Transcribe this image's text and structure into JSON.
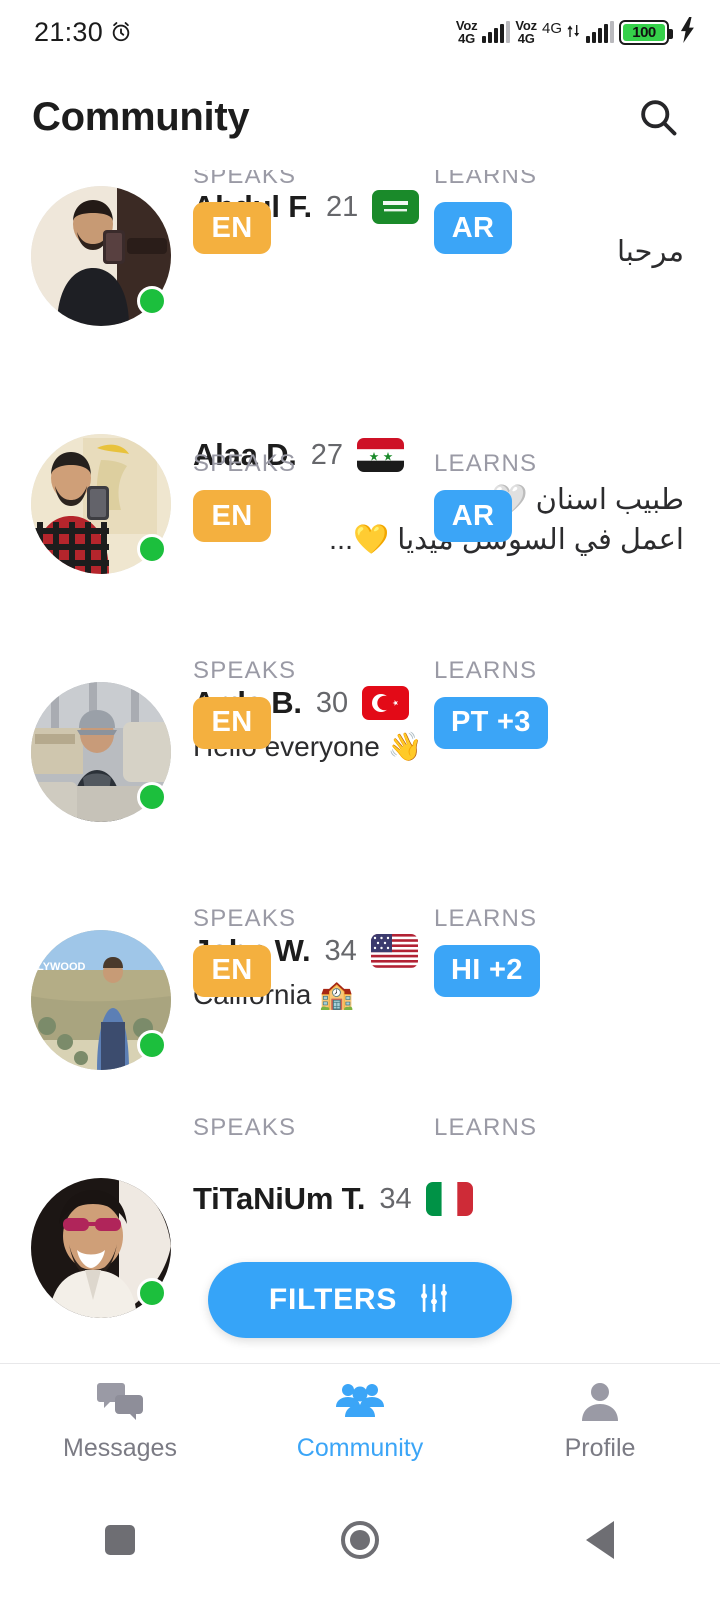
{
  "status_bar": {
    "time": "21:30",
    "alarm_icon": "alarm-clock-icon",
    "sim1_voice": "Voz",
    "sim1_net": "4G",
    "sim2_voice": "Voz",
    "sim2_net": "4G",
    "data_net": "4G",
    "battery_level": "100",
    "battery_color": "#35d14a",
    "charging": true
  },
  "header": {
    "title": "Community",
    "search_icon": "search-icon"
  },
  "labels": {
    "speaks": "SPEAKS",
    "learns": "LEARNS"
  },
  "colors": {
    "speaks_badge": "#f4b03f",
    "learns_badge": "#3ba5f7",
    "accent": "#3ba5f7",
    "online_dot": "#1cbf3d",
    "muted_text": "#9a9aa5"
  },
  "users": [
    {
      "name": "Abdul F.",
      "age": "21",
      "country": "Saudi Arabia",
      "flag": "sa",
      "message": "مرحبا",
      "message_dir": "rtl",
      "online": true,
      "speaks": "EN",
      "learns": "AR"
    },
    {
      "name": "Alaa D.",
      "age": "27",
      "country": "Syria",
      "flag": "sy",
      "message": "طبيب اسنان 🤍\nاعمل في السوشل ميديا 💛...",
      "message_dir": "rtl",
      "online": true,
      "speaks": "EN",
      "learns": "AR"
    },
    {
      "name": "Arda B.",
      "age": "30",
      "country": "Turkey",
      "flag": "tr",
      "message": "Hello everyone 👋",
      "message_dir": "ltr",
      "online": true,
      "speaks": "EN",
      "learns": "PT +3"
    },
    {
      "name": "John W.",
      "age": "34",
      "country": "United States",
      "flag": "us",
      "message": "California 🏫",
      "message_dir": "ltr",
      "online": true,
      "speaks": "EN",
      "learns": "HI +2"
    },
    {
      "name": "TiTaNiUm T.",
      "age": "34",
      "country": "Italy",
      "flag": "it",
      "message": "",
      "message_dir": "ltr",
      "online": true,
      "speaks": "",
      "learns": ""
    }
  ],
  "filters_button": {
    "label": "FILTERS",
    "icon": "sliders-icon"
  },
  "bottom_nav": [
    {
      "label": "Messages",
      "icon": "chat-bubbles-icon",
      "active": false
    },
    {
      "label": "Community",
      "icon": "people-group-icon",
      "active": true
    },
    {
      "label": "Profile",
      "icon": "person-icon",
      "active": false
    }
  ],
  "android_nav": [
    {
      "icon": "recents-square-icon"
    },
    {
      "icon": "home-circle-icon"
    },
    {
      "icon": "back-triangle-icon"
    }
  ]
}
